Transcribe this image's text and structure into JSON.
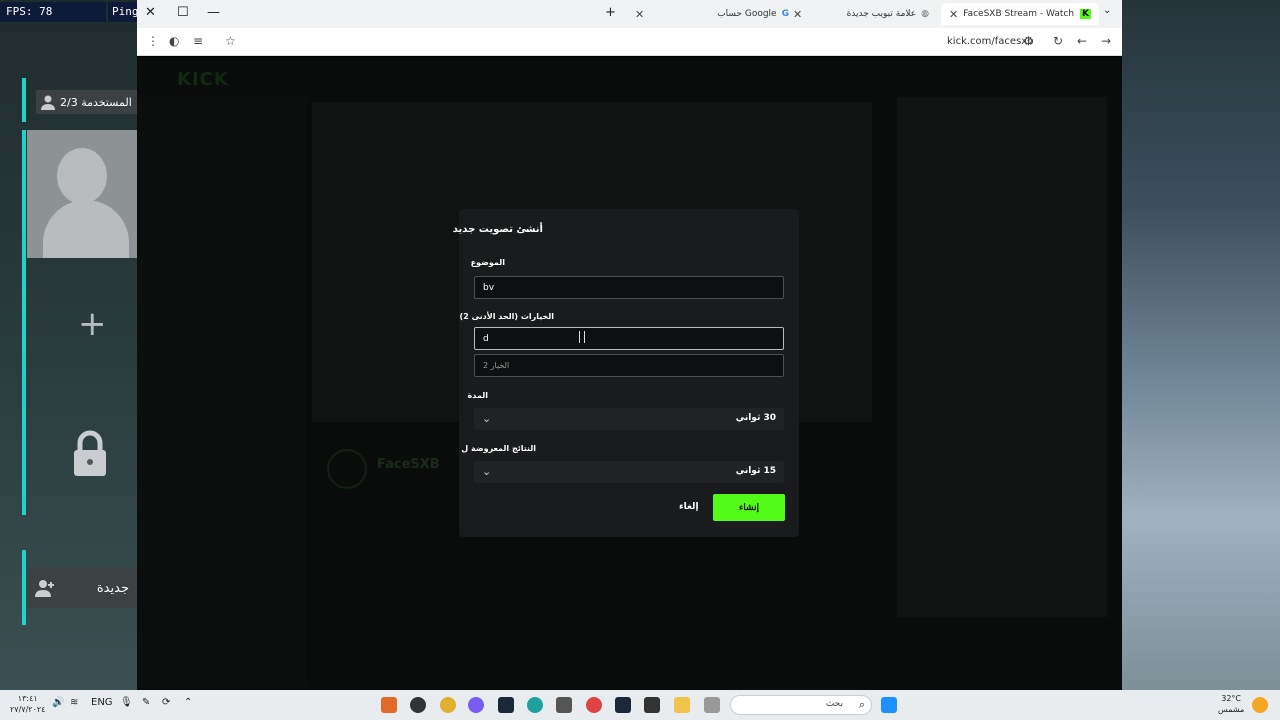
{
  "overlay": {
    "fps": "FPS: 78",
    "ping": "Ping",
    "user_count": "2/3 المستخدمة",
    "new_user": "جديدة"
  },
  "browser": {
    "tabs": [
      {
        "label": "FaceSXB Stream - Watch Li"
      },
      {
        "label": "علامة تبويب جديدة"
      },
      {
        "label": "حساب Google"
      }
    ],
    "url": "kick.com/facesxb"
  },
  "background": {
    "logo": "KICK",
    "channel": "FaceSXB"
  },
  "modal": {
    "title": "أنشئ تصويت جديد",
    "topic_label": "الموضوع",
    "topic_value": "bv",
    "options_label": "الخيارات (الحد الأدنى 2)",
    "option1_value": "d",
    "option2_placeholder": "الخيار 2",
    "duration_label": "المدة",
    "duration_value": "30 ثواني",
    "results_label": "النتائج المعروضة ل",
    "results_value": "15 ثواني",
    "create_label": "إنشاء",
    "cancel_label": "إلغاء"
  },
  "taskbar": {
    "time": "١٣:٤١",
    "date": "٢٧/٧/٢٠٢٤",
    "lang": "ENG",
    "search_placeholder": "بحث",
    "weather_temp": "32°C",
    "weather_desc": "مشمس"
  },
  "colors": {
    "accent": "#53fc18",
    "overlay_bar": "#22d1c8"
  }
}
